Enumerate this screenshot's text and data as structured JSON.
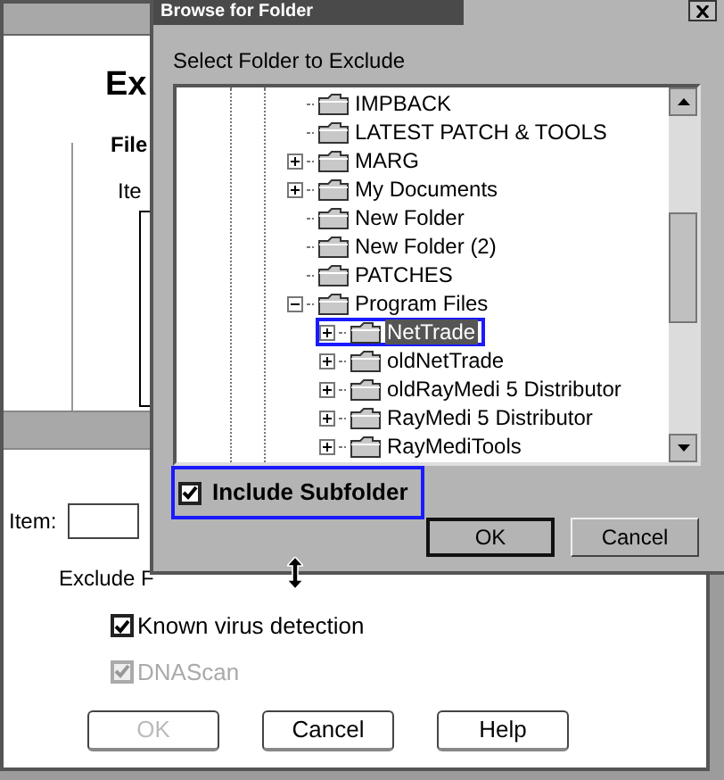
{
  "background_dialog": {
    "heading": "Ex",
    "files_label": "File",
    "item_label_top": "Ite",
    "item_label": "Item:",
    "exclude_label": "Exclude F",
    "checkboxes": [
      {
        "label": "Known virus detection",
        "checked": true,
        "disabled": false
      },
      {
        "label": "DNAScan",
        "checked": true,
        "disabled": true
      }
    ],
    "buttons": [
      {
        "label": "OK",
        "disabled": true
      },
      {
        "label": "Cancel",
        "disabled": false
      },
      {
        "label": "Help",
        "disabled": false
      }
    ]
  },
  "browse_dialog": {
    "title": "Browse for Folder",
    "prompt": "Select Folder to Exclude",
    "tree": [
      {
        "label": "IMPBACK",
        "selected": false
      },
      {
        "label": "LATEST PATCH & TOOLS",
        "selected": false
      },
      {
        "label": "MARG",
        "selected": false,
        "expanded": false
      },
      {
        "label": "My Documents",
        "selected": false,
        "expanded": false
      },
      {
        "label": "New Folder",
        "selected": false
      },
      {
        "label": "New Folder (2)",
        "selected": false
      },
      {
        "label": "PATCHES",
        "selected": false
      },
      {
        "label": "Program Files",
        "selected": false,
        "expanded": true,
        "children": [
          {
            "label": "NetTrade",
            "selected": true,
            "expanded": false,
            "highlighted": true
          },
          {
            "label": "oldNetTrade",
            "selected": false,
            "expanded": false
          },
          {
            "label": "oldRayMedi 5 Distributor",
            "selected": false,
            "expanded": false
          },
          {
            "label": "RayMedi 5 Distributor",
            "selected": false,
            "expanded": false
          },
          {
            "label": "RayMediTools",
            "selected": false,
            "expanded": false
          }
        ]
      }
    ],
    "include_subfolder": {
      "label": "Include Subfolder",
      "checked": true,
      "highlighted": true
    },
    "buttons": [
      {
        "label": "OK",
        "default": true
      },
      {
        "label": "Cancel",
        "default": false
      }
    ]
  }
}
